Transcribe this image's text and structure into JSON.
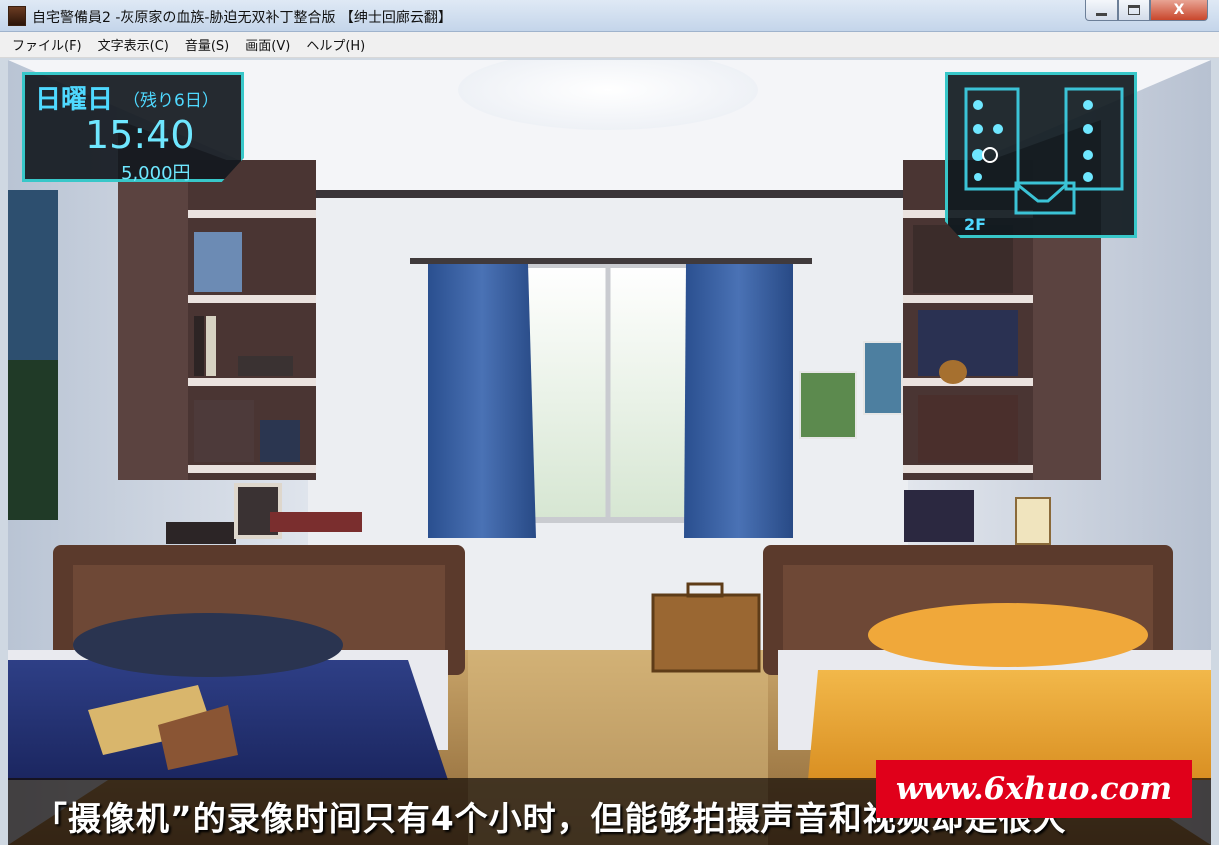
{
  "window": {
    "title": "自宅警備員2 -灰原家の血族-胁迫无双补丁整合版 【绅士回廊云翻】",
    "close_glyph": "X"
  },
  "menu": {
    "items": [
      {
        "label": "ファイル(F)"
      },
      {
        "label": "文字表示(C)"
      },
      {
        "label": "音量(S)"
      },
      {
        "label": "画面(V)"
      },
      {
        "label": "ヘルプ(H)"
      }
    ]
  },
  "hud": {
    "day": "日曜日",
    "days_left": "（残り6日）",
    "time": "15:40",
    "money": "5,000円",
    "map_floor": "2F"
  },
  "dialogue": {
    "text": "「摄像机”的录像时间只有4个小时，但能够拍摄声音和视频却是很大"
  },
  "watermark": {
    "text": "www.6xhuo.com"
  },
  "colors": {
    "hud_accent": "#38c7c9",
    "hud_text": "#4fd9ff",
    "watermark_bg": "#e0001a"
  }
}
